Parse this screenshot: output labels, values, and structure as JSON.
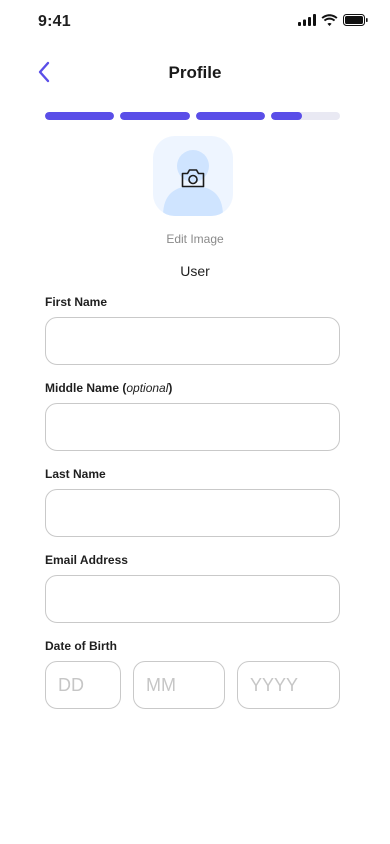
{
  "status_bar": {
    "time": "9:41"
  },
  "header": {
    "title": "Profile"
  },
  "progress": {
    "steps": [
      1,
      1,
      1,
      0.45
    ]
  },
  "avatar": {
    "edit_label": "Edit Image",
    "user_name": "User"
  },
  "form": {
    "first_name": {
      "label": "First Name",
      "value": ""
    },
    "middle_name": {
      "label": "Middle Name (",
      "label_hint": "optional",
      "label_close": ")",
      "value": ""
    },
    "last_name": {
      "label": "Last Name",
      "value": ""
    },
    "email": {
      "label": "Email Address",
      "value": ""
    },
    "dob": {
      "label": "Date of Birth",
      "day_placeholder": "DD",
      "month_placeholder": "MM",
      "year_placeholder": "YYYY"
    }
  },
  "colors": {
    "accent": "#5a4ee8",
    "avatar_bg": "#eef5ff",
    "avatar_figure": "#cfe4ff",
    "border": "#c9c9c9",
    "muted": "#8a8a8a"
  }
}
